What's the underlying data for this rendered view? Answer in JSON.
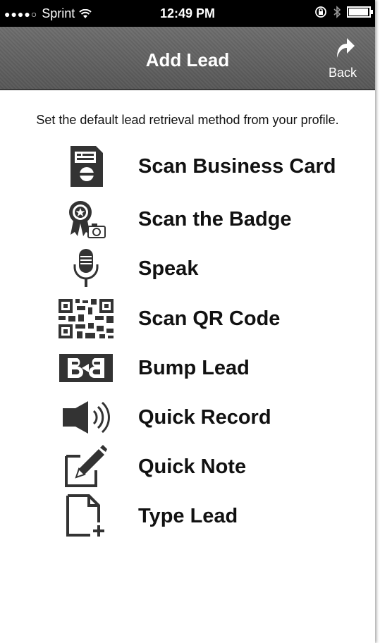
{
  "status_bar": {
    "signal": "●●●●○",
    "carrier": "Sprint",
    "time": "12:49 PM",
    "battery_level": 0.95
  },
  "nav": {
    "title": "Add Lead",
    "back_label": "Back"
  },
  "hint": "Set the default lead retrieval method from your profile.",
  "methods": [
    {
      "label": "Scan Business Card",
      "icon": "business-card-icon"
    },
    {
      "label": "Scan the Badge",
      "icon": "badge-camera-icon"
    },
    {
      "label": "Speak",
      "icon": "microphone-icon"
    },
    {
      "label": "Scan QR Code",
      "icon": "qr-code-icon"
    },
    {
      "label": "Bump Lead",
      "icon": "bump-icon"
    },
    {
      "label": "Quick Record",
      "icon": "speaker-icon"
    },
    {
      "label": "Quick Note",
      "icon": "pencil-note-icon"
    },
    {
      "label": "Type Lead",
      "icon": "new-document-icon"
    }
  ]
}
